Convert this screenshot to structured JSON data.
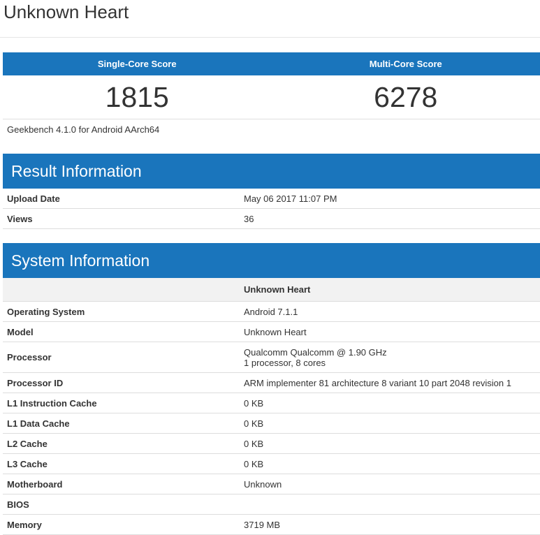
{
  "page": {
    "title": "Unknown Heart"
  },
  "scores": {
    "single_label": "Single-Core Score",
    "multi_label": "Multi-Core Score",
    "single_value": "1815",
    "multi_value": "6278",
    "version": "Geekbench 4.1.0 for Android AArch64"
  },
  "result_info": {
    "heading": "Result Information",
    "rows": [
      {
        "label": "Upload Date",
        "value": "May 06 2017 11:07 PM"
      },
      {
        "label": "Views",
        "value": "36"
      }
    ]
  },
  "system_info": {
    "heading": "System Information",
    "device_name": "Unknown Heart",
    "rows": [
      {
        "label": "Operating System",
        "value": "Android 7.1.1"
      },
      {
        "label": "Model",
        "value": "Unknown Heart"
      },
      {
        "label": "Processor",
        "value": "Qualcomm Qualcomm @ 1.90 GHz",
        "value2": "1 processor, 8 cores"
      },
      {
        "label": "Processor ID",
        "value": "ARM implementer 81 architecture 8 variant 10 part 2048 revision 1"
      },
      {
        "label": "L1 Instruction Cache",
        "value": "0 KB"
      },
      {
        "label": "L1 Data Cache",
        "value": "0 KB"
      },
      {
        "label": "L2 Cache",
        "value": "0 KB"
      },
      {
        "label": "L3 Cache",
        "value": "0 KB"
      },
      {
        "label": "Motherboard",
        "value": "Unknown"
      },
      {
        "label": "BIOS",
        "value": ""
      },
      {
        "label": "Memory",
        "value": "3719 MB"
      }
    ]
  },
  "colors": {
    "accent": "#1a75bc",
    "text": "#333333",
    "device_row_bg": "#f2f2f2"
  }
}
